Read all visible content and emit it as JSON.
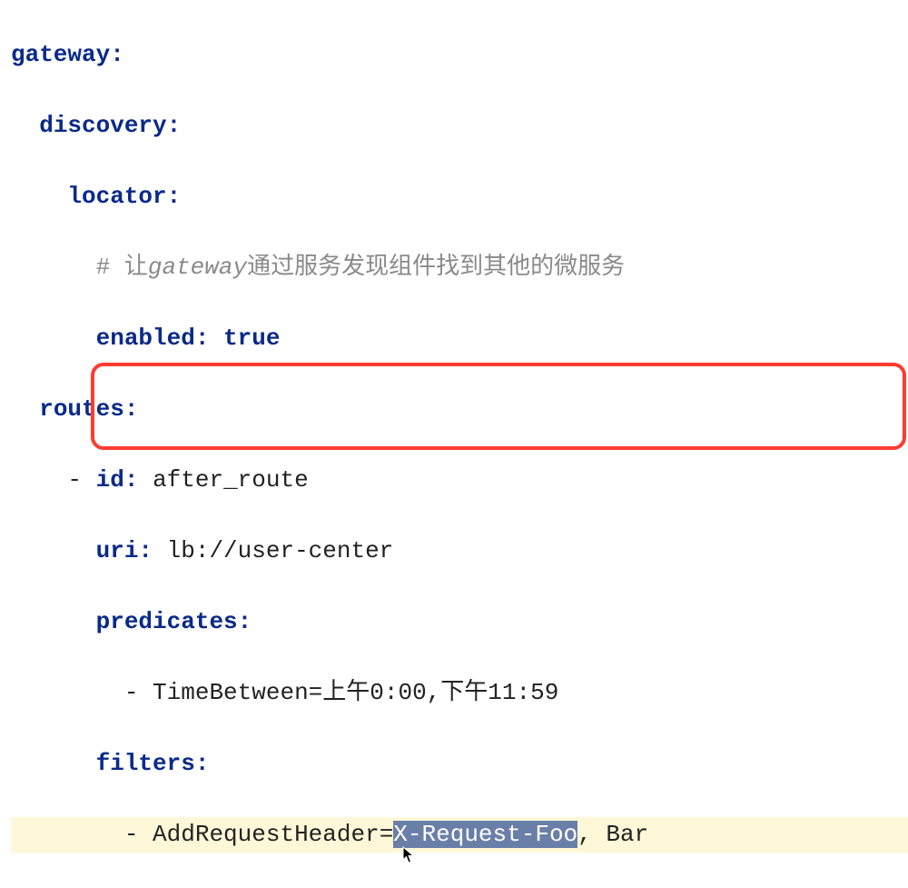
{
  "lines": {
    "l1_key": "gateway:",
    "l2_key": "discovery:",
    "l3_key": "locator:",
    "l4_comment_prefix": "# 让",
    "l4_comment_ital": "gateway",
    "l4_comment_rest": "通过服务发现组件找到其他的微服务",
    "l5_key": "enabled: ",
    "l5_val": "true",
    "l6_key": "routes:",
    "l7_dash": "- ",
    "l7_key": "id: ",
    "l7_val": "after_route",
    "l8_key": "uri: ",
    "l8_val": "lb://user-center",
    "l9_key": "predicates:",
    "l10_dash": "- ",
    "l10_val": "TimeBetween=上午0:00,下午11:59",
    "l11_key": "filters:",
    "l12_dash": "- ",
    "l12_pre": "AddRequestHeader=",
    "l12_sel_a": "X",
    "l12_sel_b": "Request-Foo",
    "l12_post": ", Bar"
  },
  "chart_data": {
    "type": "table",
    "title": "Spring Cloud Gateway YAML configuration (highlighted filter)",
    "yaml": {
      "gateway": {
        "discovery": {
          "locator": {
            "_comment": "让gateway通过服务发现组件找到其他的微服务",
            "enabled": true
          }
        },
        "routes": [
          {
            "id": "after_route",
            "uri": "lb://user-center",
            "predicates": [
              "TimeBetween=上午0:00,下午11:59"
            ],
            "filters": [
              "AddRequestHeader=X-Request-Foo, Bar"
            ]
          }
        ]
      }
    },
    "highlighted_selection": "X-Request-Foo",
    "boxed_lines": [
      "filters:",
      "- AddRequestHeader=X-Request-Foo, Bar"
    ]
  }
}
